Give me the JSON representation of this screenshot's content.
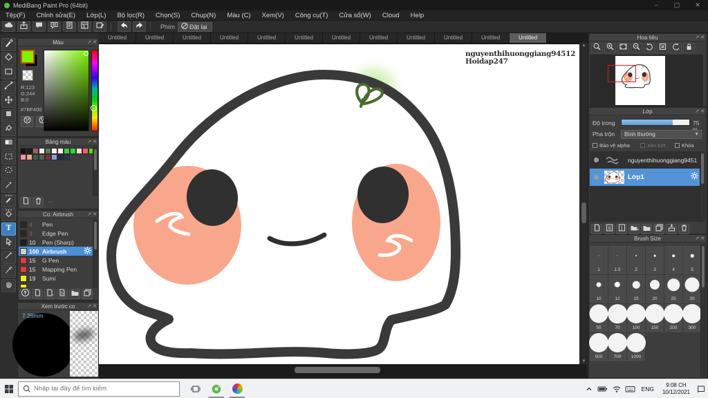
{
  "window": {
    "title": "MediBang Paint Pro (64bit)",
    "minimize": "–",
    "maximize": "▢",
    "close": "✕"
  },
  "menu_items": [
    "Tệp(F)",
    "Chỉnh sửa(E)",
    "Lớp(L)",
    "Bộ lọc(R)",
    "Chọn(S)",
    "Chụp(N)",
    "Màu (C)",
    "Xem(V)",
    "Công cụ(T)",
    "Cửa sổ(W)",
    "Cloud",
    "Help"
  ],
  "quick_toolbar": {
    "buttons": [
      "cloud",
      "publish",
      "comment",
      "chat",
      "note",
      "material",
      "edit-panel"
    ],
    "key_label": "Phím",
    "reset_button": "Đặt lại"
  },
  "tabs": {
    "label": "Untitled",
    "count": 12,
    "active_index": 11
  },
  "tool_strip": [
    "brush",
    "eraser",
    "select-rect",
    "control-pen",
    "move",
    "fill-rect",
    "bucket",
    "gradient",
    "select",
    "lasso",
    "magic-wand",
    "select-pen",
    "select-eraser",
    "text",
    "operation",
    "divide",
    "eyedropper",
    "hand"
  ],
  "active_tool": "text",
  "color_panel": {
    "title": "Màu",
    "r_label": "R:123",
    "g_label": "G:244",
    "b_label": "B:0",
    "hex": "#7BF400",
    "foreground_color": "#7bf400"
  },
  "palette_panel": {
    "title": "Bảng màu",
    "colors": [
      "#111111",
      "#1a1a1a",
      "#9b5f5f",
      "#f6efe7",
      "#5d7a60",
      "#f4f4f1",
      "#f8ece6",
      "#40c940",
      "#35d435",
      "#f2dcd6",
      "#f45f74",
      "#55e000",
      "#f591b0",
      "#f5a68d",
      "#3f5c42",
      "#50605a",
      "#7c3038",
      "#93a0cf",
      "#1f2c4e",
      "#243455"
    ]
  },
  "brush_panel": {
    "title": "Cọ: Airbrush",
    "buttons": [
      "upload-brush",
      "new-brush",
      "brush-menu",
      "save-brush",
      "brush-folder",
      "duplicate-brush"
    ],
    "brushes": [
      {
        "num": "4",
        "name": "Pen",
        "swatch": "#262626",
        "num_color": "#c0504d",
        "selected": false
      },
      {
        "num": "3",
        "name": "Edge Pen",
        "swatch": "#262626",
        "num_color": "#c0504d",
        "selected": false
      },
      {
        "num": "10",
        "name": "Pen (Sharp)",
        "swatch": "#1d1d1d",
        "num_color": "#e8e8e8",
        "selected": false
      },
      {
        "num": "100",
        "name": "Airbrush",
        "swatch": "#ccd2d4",
        "num_color": "#ffffff",
        "selected": true
      },
      {
        "num": "15",
        "name": "G Pen",
        "swatch": "#e23b3b",
        "num_color": "#e8e8e8",
        "selected": false
      },
      {
        "num": "15",
        "name": "Mapping Pen",
        "swatch": "#e23b3b",
        "num_color": "#e8e8e8",
        "selected": false
      },
      {
        "num": "19",
        "name": "Sumi",
        "swatch": "#f5e926",
        "num_color": "#e8e8e8",
        "selected": false
      },
      {
        "num": "",
        "name": "",
        "swatch": "#f5e926",
        "num_color": "#e8e8e8",
        "selected": false
      }
    ]
  },
  "preview_panel": {
    "title": "Xem trước cọ",
    "brush_width": "7.26mm"
  },
  "canvas": {
    "watermark_line1": "nguyenthihuonggiang94512",
    "watermark_line2": "Hoidap247",
    "cheek_color": "#f9a78c",
    "outline_color": "#3a3a3a"
  },
  "navigator_panel": {
    "title": "Hoa tiêu",
    "buttons": [
      "zoom-area",
      "zoom-in",
      "fit-screen",
      "zoom-out",
      "rotate-left",
      "reset-view",
      "rotate-right",
      "lock"
    ]
  },
  "layer_panel": {
    "title": "Lớp",
    "opacity_label": "Độ trong",
    "opacity_text": "75 %",
    "opacity_percent": 75,
    "blend_label": "Pha trộn",
    "blend_mode": "Bình thường",
    "alpha_lock_label": "Bảo vệ alpha",
    "clip_label": "Xén bớt",
    "lock_label": "Khóa",
    "selection_color": "#5593d8",
    "layers": [
      {
        "name": "nguyenthihuonggiang9451",
        "thumb": "scribble",
        "selected": false
      },
      {
        "name": "Lớp1",
        "thumb": "face",
        "selected": true
      }
    ],
    "buttons": [
      "new-layer",
      "layer-8bit",
      "layer-1bit",
      "add-folder",
      "folder",
      "duplicate-layer",
      "merge-layer",
      "delete-layer"
    ]
  },
  "brush_size_panel": {
    "title": "Brush Size",
    "sizes": [
      "1",
      "1.5",
      "2",
      "3",
      "4",
      "5",
      "10",
      "12",
      "15",
      "20",
      "25",
      "30",
      "50",
      "70",
      "100",
      "150",
      "200",
      "300",
      "500",
      "700",
      "1000"
    ]
  },
  "taskbar": {
    "search_placeholder": "Nhập tại đây để tìm kiếm",
    "language": "ENG",
    "time": "9:08 CH",
    "date": "10/12/2021"
  }
}
